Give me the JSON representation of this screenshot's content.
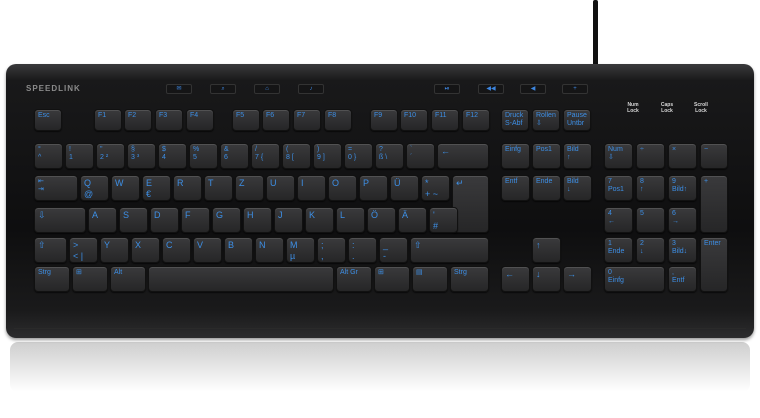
{
  "brand": "SPEEDLINK",
  "indicators": [
    "Num\nLock",
    "Caps\nLock",
    "Scroll\nLock"
  ],
  "media_keys": [
    "✉",
    "⌕",
    "⌂",
    "♪",
    "⏯",
    "◀◀",
    "◀",
    "+"
  ],
  "rows": {
    "fn": [
      "Esc",
      "F1",
      "F2",
      "F3",
      "F4",
      "F5",
      "F6",
      "F7",
      "F8",
      "F9",
      "F10",
      "F11",
      "F12",
      "Druck\nS-Abf",
      "Rollen\n⇩",
      "Pause\nUntbr"
    ],
    "num": [
      "°\n^",
      "!\n1",
      "\"\n2  ²",
      "§\n3  ³",
      "$\n4",
      "%\n5",
      "&\n6",
      "/\n7  {",
      "(\n8  [",
      ")\n9  ]",
      "=\n0  }",
      "?\nß  \\",
      "`\n´",
      "←"
    ],
    "q": [
      "⇤\n⇥",
      "Q\n@",
      "W",
      "E\n€",
      "R",
      "T",
      "Z",
      "U",
      "I",
      "O",
      "P",
      "Ü",
      "*\n+  ~",
      "↵"
    ],
    "a": [
      "⇩",
      "A",
      "S",
      "D",
      "F",
      "G",
      "H",
      "J",
      "K",
      "L",
      "Ö",
      "Ä",
      "'\n#"
    ],
    "z": [
      "⇧",
      ">\n<  |",
      "Y",
      "X",
      "C",
      "V",
      "B",
      "N",
      "M\nµ",
      ";\n,",
      ":\n.",
      "_\n-",
      "⇧"
    ],
    "bottom": [
      "Strg",
      "⊞",
      "Alt",
      "",
      "Alt Gr",
      "⊞",
      "▤",
      "Strg"
    ],
    "nav": [
      "Einfg",
      "Pos1",
      "Bild\n↑",
      "Entf",
      "Ende",
      "Bild\n↓"
    ],
    "arrows": [
      "↑",
      "←",
      "↓",
      "→"
    ],
    "numpad": [
      "Num\n⇩",
      "÷",
      "×",
      "−",
      "7\nPos1",
      "8\n↑",
      "9\nBild↑",
      "+",
      "4\n←",
      "5",
      "6\n→",
      "1\nEnde",
      "2\n↓",
      "3\nBild↓",
      "Enter",
      "0\nEinfg",
      ",\nEntf"
    ]
  }
}
